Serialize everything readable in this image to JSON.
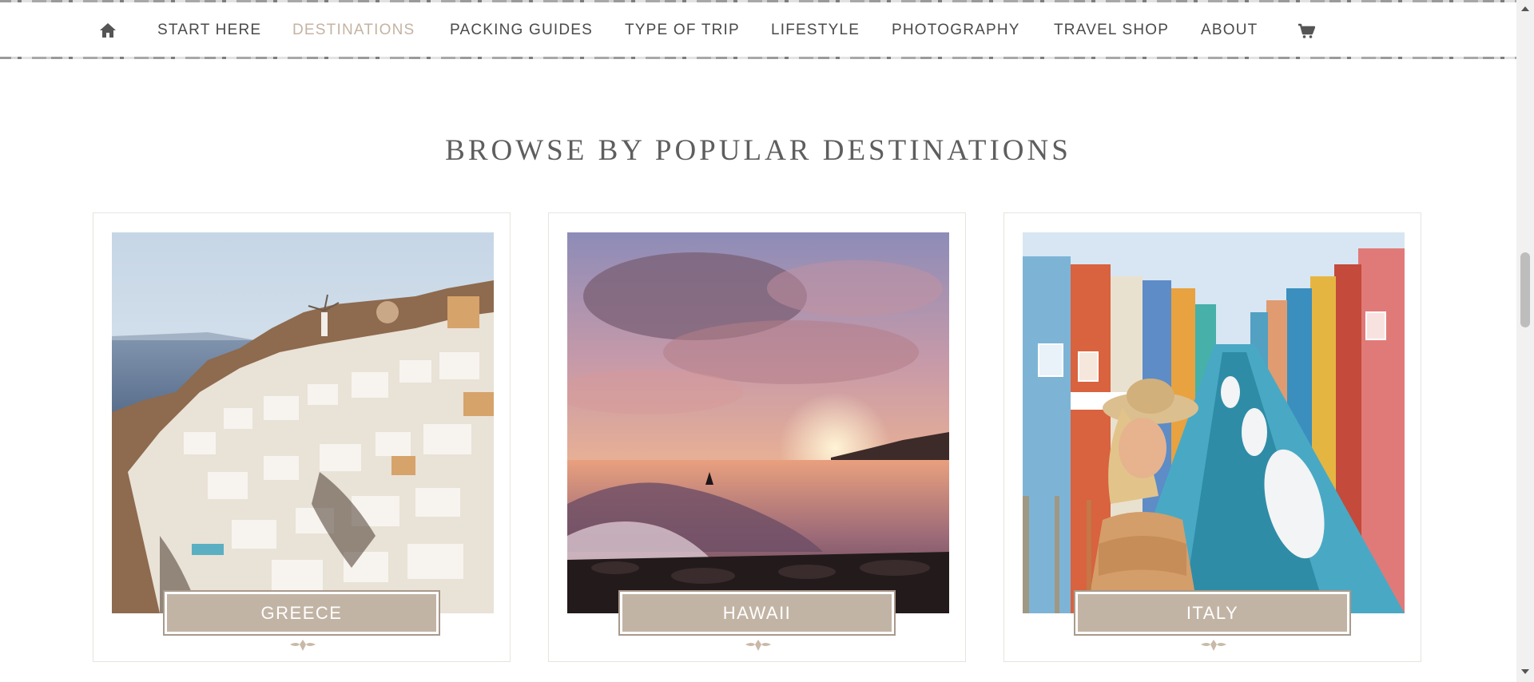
{
  "nav": {
    "home_icon": "home-icon",
    "cart_icon": "cart-icon",
    "items": [
      {
        "label": "START HERE",
        "active": false
      },
      {
        "label": "DESTINATIONS",
        "active": true
      },
      {
        "label": "PACKING GUIDES",
        "active": false
      },
      {
        "label": "TYPE OF TRIP",
        "active": false
      },
      {
        "label": "LIFESTYLE",
        "active": false
      },
      {
        "label": "PHOTOGRAPHY",
        "active": false
      },
      {
        "label": "TRAVEL SHOP",
        "active": false
      },
      {
        "label": "ABOUT",
        "active": false
      }
    ]
  },
  "section": {
    "title": "BROWSE BY POPULAR DESTINATIONS"
  },
  "cards": [
    {
      "label": "GREECE",
      "image": "santorini-village-photo"
    },
    {
      "label": "HAWAII",
      "image": "ocean-sunset-surfer-photo"
    },
    {
      "label": "ITALY",
      "image": "burano-canal-photo"
    }
  ],
  "colors": {
    "accent": "#c4b3a2",
    "label_bg": "#c2b4a5",
    "text": "#4a4a4a",
    "heading": "#5e5e5e"
  }
}
